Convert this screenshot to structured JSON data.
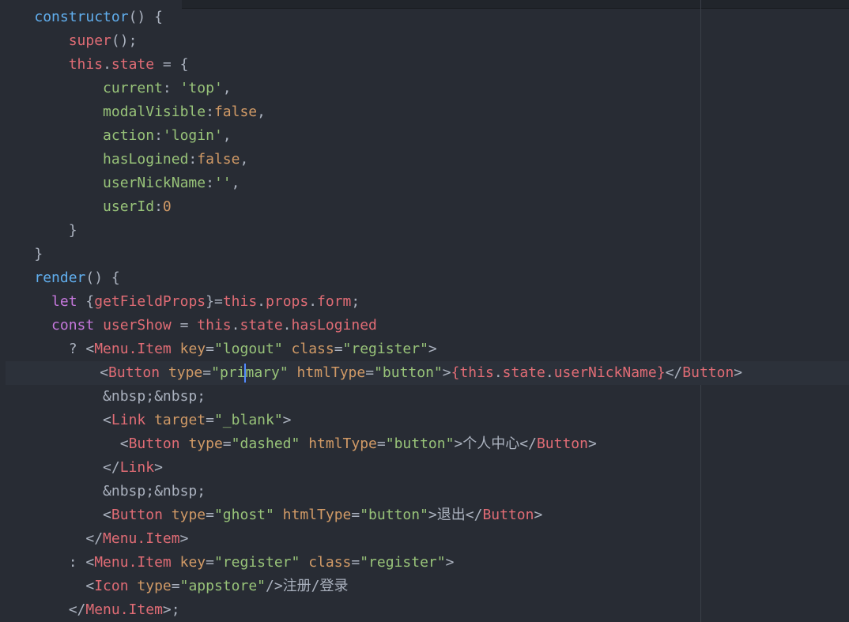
{
  "colors": {
    "background": "#282c34",
    "function": "#61afef",
    "keyword": "#c678dd",
    "tag": "#e06c75",
    "string": "#98c379",
    "number": "#d19a66",
    "attribute": "#d19a66",
    "plain": "#abb2bf",
    "cursor": "#528bff"
  },
  "lines": [
    [
      {
        "t": "    ",
        "c": "pl"
      },
      {
        "t": "constructor",
        "c": "fn"
      },
      {
        "t": "() {",
        "c": "pl"
      }
    ],
    [
      {
        "t": "        ",
        "c": "pl"
      },
      {
        "t": "super",
        "c": "red"
      },
      {
        "t": "();",
        "c": "pl"
      }
    ],
    [
      {
        "t": "        ",
        "c": "pl"
      },
      {
        "t": "this",
        "c": "red"
      },
      {
        "t": ".",
        "c": "pl"
      },
      {
        "t": "state",
        "c": "red"
      },
      {
        "t": " = {",
        "c": "pl"
      }
    ],
    [
      {
        "t": "            ",
        "c": "pl"
      },
      {
        "t": "current",
        "c": "prop"
      },
      {
        "t": ": ",
        "c": "pl"
      },
      {
        "t": "'top'",
        "c": "str"
      },
      {
        "t": ",",
        "c": "pl"
      }
    ],
    [
      {
        "t": "            ",
        "c": "pl"
      },
      {
        "t": "modalVisible",
        "c": "prop"
      },
      {
        "t": ":",
        "c": "pl"
      },
      {
        "t": "false",
        "c": "num"
      },
      {
        "t": ",",
        "c": "pl"
      }
    ],
    [
      {
        "t": "            ",
        "c": "pl"
      },
      {
        "t": "action",
        "c": "prop"
      },
      {
        "t": ":",
        "c": "pl"
      },
      {
        "t": "'login'",
        "c": "str"
      },
      {
        "t": ",",
        "c": "pl"
      }
    ],
    [
      {
        "t": "            ",
        "c": "pl"
      },
      {
        "t": "hasLogined",
        "c": "prop"
      },
      {
        "t": ":",
        "c": "pl"
      },
      {
        "t": "false",
        "c": "num"
      },
      {
        "t": ",",
        "c": "pl"
      }
    ],
    [
      {
        "t": "            ",
        "c": "pl"
      },
      {
        "t": "userNickName",
        "c": "prop"
      },
      {
        "t": ":",
        "c": "pl"
      },
      {
        "t": "''",
        "c": "str"
      },
      {
        "t": ",",
        "c": "pl"
      }
    ],
    [
      {
        "t": "            ",
        "c": "pl"
      },
      {
        "t": "userId",
        "c": "prop"
      },
      {
        "t": ":",
        "c": "pl"
      },
      {
        "t": "0",
        "c": "num"
      }
    ],
    [
      {
        "t": "        }",
        "c": "pl"
      }
    ],
    [
      {
        "t": "    }",
        "c": "pl"
      }
    ],
    [
      {
        "t": "    ",
        "c": "pl"
      },
      {
        "t": "render",
        "c": "fn"
      },
      {
        "t": "() {",
        "c": "pl"
      }
    ],
    [
      {
        "t": "      ",
        "c": "pl"
      },
      {
        "t": "let",
        "c": "kw"
      },
      {
        "t": " {",
        "c": "pl"
      },
      {
        "t": "getFieldProps",
        "c": "red"
      },
      {
        "t": "}=",
        "c": "pl"
      },
      {
        "t": "this",
        "c": "red"
      },
      {
        "t": ".",
        "c": "pl"
      },
      {
        "t": "props",
        "c": "red"
      },
      {
        "t": ".",
        "c": "pl"
      },
      {
        "t": "form",
        "c": "red"
      },
      {
        "t": ";",
        "c": "pl"
      }
    ],
    [
      {
        "t": "      ",
        "c": "pl"
      },
      {
        "t": "const",
        "c": "kw"
      },
      {
        "t": " ",
        "c": "pl"
      },
      {
        "t": "userShow",
        "c": "red"
      },
      {
        "t": " = ",
        "c": "pl"
      },
      {
        "t": "this",
        "c": "red"
      },
      {
        "t": ".",
        "c": "pl"
      },
      {
        "t": "state",
        "c": "red"
      },
      {
        "t": ".",
        "c": "pl"
      },
      {
        "t": "hasLogined",
        "c": "red"
      }
    ],
    [
      {
        "t": "        ? <",
        "c": "pl"
      },
      {
        "t": "Menu.Item",
        "c": "tag"
      },
      {
        "t": " ",
        "c": "pl"
      },
      {
        "t": "key",
        "c": "attr"
      },
      {
        "t": "=",
        "c": "pl"
      },
      {
        "t": "\"logout\"",
        "c": "str"
      },
      {
        "t": " ",
        "c": "pl"
      },
      {
        "t": "class",
        "c": "attr"
      },
      {
        "t": "=",
        "c": "pl"
      },
      {
        "t": "\"register\"",
        "c": "str"
      },
      {
        "t": ">",
        "c": "pl"
      }
    ],
    [
      {
        "t": "           <",
        "c": "pl"
      },
      {
        "t": "Button",
        "c": "tag"
      },
      {
        "t": " ",
        "c": "pl"
      },
      {
        "t": "type",
        "c": "attr"
      },
      {
        "t": "=",
        "c": "pl"
      },
      {
        "t": "\"pri",
        "c": "str"
      },
      {
        "t": "",
        "c": "cursor"
      },
      {
        "t": "mary\"",
        "c": "str"
      },
      {
        "t": " ",
        "c": "pl"
      },
      {
        "t": "htmlType",
        "c": "attr"
      },
      {
        "t": "=",
        "c": "pl"
      },
      {
        "t": "\"button\"",
        "c": "str"
      },
      {
        "t": ">",
        "c": "pl"
      },
      {
        "t": "{",
        "c": "red"
      },
      {
        "t": "this",
        "c": "red"
      },
      {
        "t": ".",
        "c": "pl"
      },
      {
        "t": "state",
        "c": "red"
      },
      {
        "t": ".",
        "c": "pl"
      },
      {
        "t": "userNickName",
        "c": "red"
      },
      {
        "t": "}",
        "c": "red"
      },
      {
        "t": "</",
        "c": "pl"
      },
      {
        "t": "Button",
        "c": "tag"
      },
      {
        "t": ">",
        "c": "pl"
      }
    ],
    [
      {
        "t": "            &nbsp;&nbsp;",
        "c": "pl"
      }
    ],
    [
      {
        "t": "            <",
        "c": "pl"
      },
      {
        "t": "Link",
        "c": "tag"
      },
      {
        "t": " ",
        "c": "pl"
      },
      {
        "t": "target",
        "c": "attr"
      },
      {
        "t": "=",
        "c": "pl"
      },
      {
        "t": "\"_blank\"",
        "c": "str"
      },
      {
        "t": ">",
        "c": "pl"
      }
    ],
    [
      {
        "t": "              <",
        "c": "pl"
      },
      {
        "t": "Button",
        "c": "tag"
      },
      {
        "t": " ",
        "c": "pl"
      },
      {
        "t": "type",
        "c": "attr"
      },
      {
        "t": "=",
        "c": "pl"
      },
      {
        "t": "\"dashed\"",
        "c": "str"
      },
      {
        "t": " ",
        "c": "pl"
      },
      {
        "t": "htmlType",
        "c": "attr"
      },
      {
        "t": "=",
        "c": "pl"
      },
      {
        "t": "\"button\"",
        "c": "str"
      },
      {
        "t": ">个人中心</",
        "c": "pl"
      },
      {
        "t": "Button",
        "c": "tag"
      },
      {
        "t": ">",
        "c": "pl"
      }
    ],
    [
      {
        "t": "            </",
        "c": "pl"
      },
      {
        "t": "Link",
        "c": "tag"
      },
      {
        "t": ">",
        "c": "pl"
      }
    ],
    [
      {
        "t": "            &nbsp;&nbsp;",
        "c": "pl"
      }
    ],
    [
      {
        "t": "            <",
        "c": "pl"
      },
      {
        "t": "Button",
        "c": "tag"
      },
      {
        "t": " ",
        "c": "pl"
      },
      {
        "t": "type",
        "c": "attr"
      },
      {
        "t": "=",
        "c": "pl"
      },
      {
        "t": "\"ghost\"",
        "c": "str"
      },
      {
        "t": " ",
        "c": "pl"
      },
      {
        "t": "htmlType",
        "c": "attr"
      },
      {
        "t": "=",
        "c": "pl"
      },
      {
        "t": "\"button\"",
        "c": "str"
      },
      {
        "t": ">退出</",
        "c": "pl"
      },
      {
        "t": "Button",
        "c": "tag"
      },
      {
        "t": ">",
        "c": "pl"
      }
    ],
    [
      {
        "t": "          </",
        "c": "pl"
      },
      {
        "t": "Menu.Item",
        "c": "tag"
      },
      {
        "t": ">",
        "c": "pl"
      }
    ],
    [
      {
        "t": "        : <",
        "c": "pl"
      },
      {
        "t": "Menu.Item",
        "c": "tag"
      },
      {
        "t": " ",
        "c": "pl"
      },
      {
        "t": "key",
        "c": "attr"
      },
      {
        "t": "=",
        "c": "pl"
      },
      {
        "t": "\"register\"",
        "c": "str"
      },
      {
        "t": " ",
        "c": "pl"
      },
      {
        "t": "class",
        "c": "attr"
      },
      {
        "t": "=",
        "c": "pl"
      },
      {
        "t": "\"register\"",
        "c": "str"
      },
      {
        "t": ">",
        "c": "pl"
      }
    ],
    [
      {
        "t": "          <",
        "c": "pl"
      },
      {
        "t": "Icon",
        "c": "tag"
      },
      {
        "t": " ",
        "c": "pl"
      },
      {
        "t": "type",
        "c": "attr"
      },
      {
        "t": "=",
        "c": "pl"
      },
      {
        "t": "\"appstore\"",
        "c": "str"
      },
      {
        "t": "/>注册/登录",
        "c": "pl"
      }
    ],
    [
      {
        "t": "        </",
        "c": "pl"
      },
      {
        "t": "Menu.Item",
        "c": "tag"
      },
      {
        "t": ">;",
        "c": "pl"
      }
    ]
  ]
}
